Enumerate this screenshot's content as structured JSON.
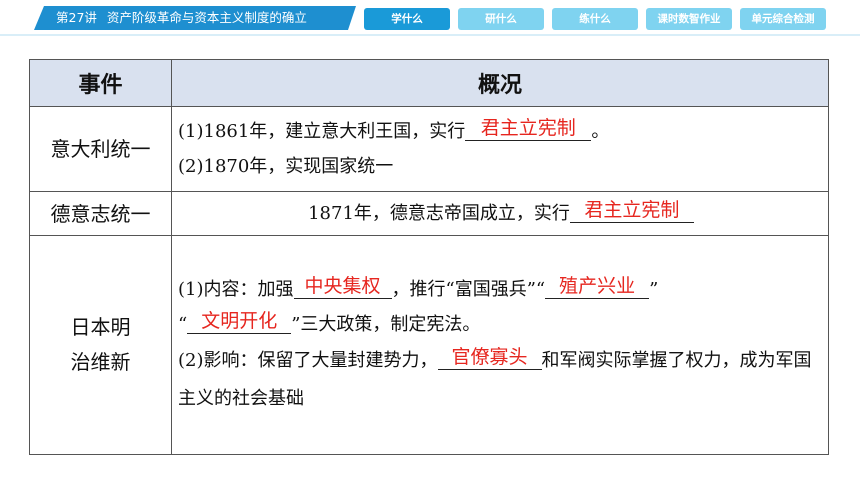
{
  "topbar": {
    "lesson": "第27讲",
    "title": "资产阶级革命与资本主义制度的确立",
    "tabs": [
      {
        "label": "学什么",
        "active": true
      },
      {
        "label": "研什么",
        "active": false
      },
      {
        "label": "练什么",
        "active": false
      },
      {
        "label": "课时数智作业",
        "active": false
      },
      {
        "label": "单元综合检测",
        "active": false
      }
    ]
  },
  "colors": {
    "accent": "#1e8fd0",
    "tab_inactive": "#7fd3f0",
    "answer_red": "#e6261f",
    "header_bg": "#d9e1ef"
  },
  "table": {
    "headers": [
      "事件",
      "概况"
    ],
    "rows": [
      {
        "event": "意大利统一",
        "line1_pre": "(1)1861年，建立意大利王国，实行",
        "line1_answer": "君主立宪制",
        "line1_post": "。",
        "line2": "(2)1870年，实现国家统一"
      },
      {
        "event": "德意志统一",
        "pre": "1871年，德意志帝国成立，实行",
        "answer": "君主立宪制"
      },
      {
        "event_line1": "日本明",
        "event_line2": "治维新",
        "content_pre": "(1)内容：加强",
        "answer1": "中央集权",
        "content_mid1": "，推行“富国强兵”“",
        "answer2": "殖产兴业",
        "content_mid2": "”",
        "content_open": "“",
        "answer3": "文明开化",
        "content_post": "”三大政策，制定宪法。",
        "influence_pre": "(2)影响：保留了大量封建势力，",
        "answer4": "官僚寡头",
        "influence_post": "和军阀实际掌握了权力，成为军国主义的社会基础"
      }
    ]
  }
}
